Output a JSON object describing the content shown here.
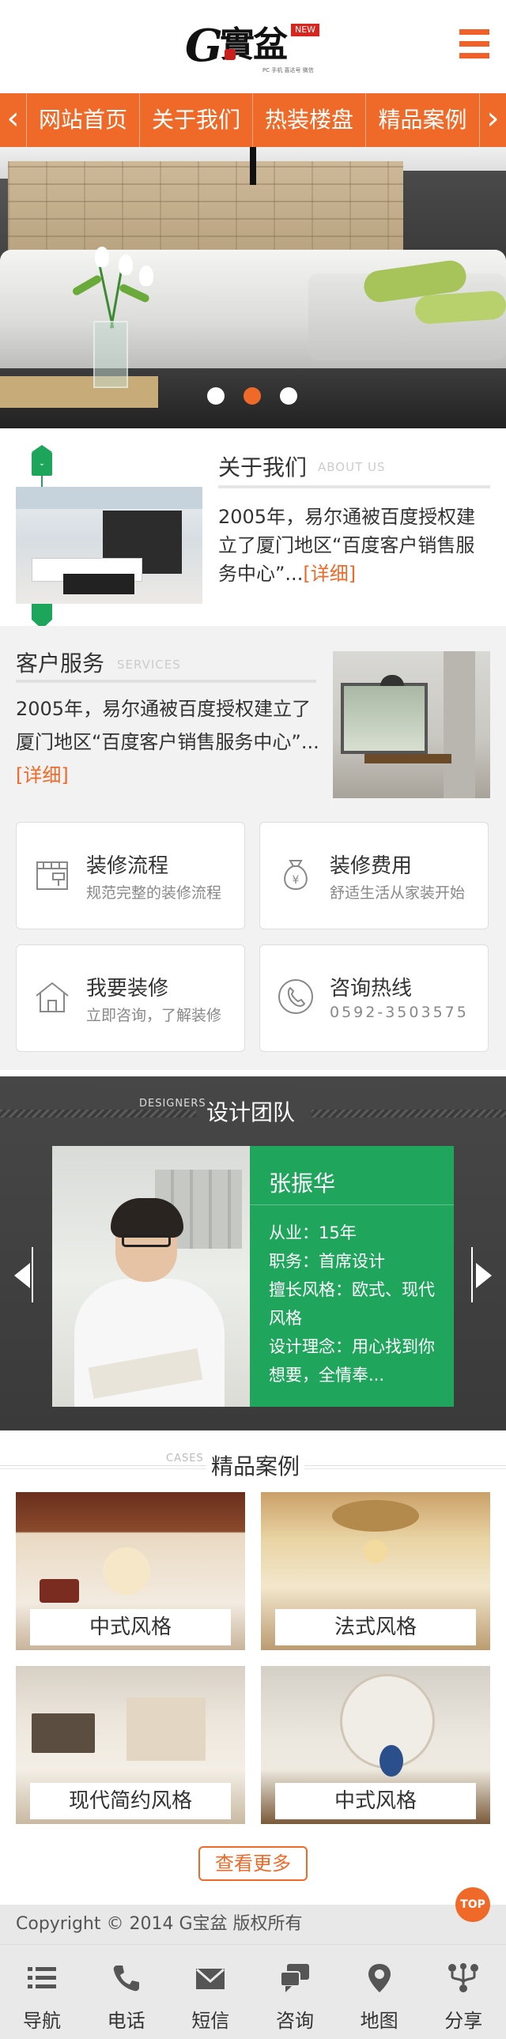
{
  "header": {
    "logo_letter": "G",
    "logo_cn": "實盆",
    "logo_badge": "NEW",
    "logo_sub": "PC 手机 喜达号 微信",
    "menu_icon": "hamburger-menu-icon"
  },
  "nav": {
    "prev_icon": "chevron-left-icon",
    "next_icon": "chevron-right-icon",
    "prev_glyph": "‹",
    "next_glyph": "›",
    "items": [
      {
        "label": "网站首页"
      },
      {
        "label": "关于我们"
      },
      {
        "label": "热装楼盘"
      },
      {
        "label": "精品案例"
      }
    ]
  },
  "banner": {
    "slides_total": 3,
    "active_slide": 2
  },
  "about": {
    "title": "关于我们",
    "title_en": "ABOUT US",
    "text": "2005年，易尔通被百度授权建立了厦门地区“百度客户销售服务中心”...",
    "more": "[详细]"
  },
  "service": {
    "title": "客户服务",
    "title_en": "SERVICES",
    "text": "2005年，易尔通被百度授权建立了厦门地区“百度客户销售服务中心”...",
    "more": "[详细]",
    "cards": [
      {
        "title": "装修流程",
        "sub": "规范完整的装修流程",
        "icon": "roller-window-icon"
      },
      {
        "title": "装修费用",
        "sub": "舒适生活从家装开始",
        "icon": "money-bag-icon"
      },
      {
        "title": "我要装修",
        "sub": "立即咨询，了解装修",
        "icon": "house-icon"
      },
      {
        "title": "咨询热线",
        "sub": "0592-3503575",
        "icon": "phone-icon"
      }
    ]
  },
  "team": {
    "title": "设计团队",
    "title_en": "DESIGNERS",
    "designer": {
      "name": "张振华",
      "line1": "从业：15年",
      "line2": "职务：首席设计",
      "line3": "擅长风格：欧式、现代风格",
      "line4": "设计理念：用心找到你想要，全情奉..."
    }
  },
  "cases": {
    "title": "精品案例",
    "title_en": "CASES",
    "items": [
      {
        "label": "中式风格"
      },
      {
        "label": "法式风格"
      },
      {
        "label": "现代简约风格"
      },
      {
        "label": "中式风格"
      }
    ],
    "more_button": "查看更多"
  },
  "footer": {
    "copyright": "Copyright © 2014 G宝盆 版权所有",
    "top_button": "TOP"
  },
  "bottom_bar": {
    "tabs": [
      {
        "label": "导航",
        "icon": "list-icon"
      },
      {
        "label": "电话",
        "icon": "phone-icon"
      },
      {
        "label": "短信",
        "icon": "envelope-icon"
      },
      {
        "label": "咨询",
        "icon": "chat-bubbles-icon"
      },
      {
        "label": "地图",
        "icon": "map-pin-icon"
      },
      {
        "label": "分享",
        "icon": "share-icon"
      }
    ]
  },
  "colors": {
    "accent_orange": "#ef6a28",
    "accent_green": "#1fa55c",
    "dark_team_bg": "#404040"
  }
}
